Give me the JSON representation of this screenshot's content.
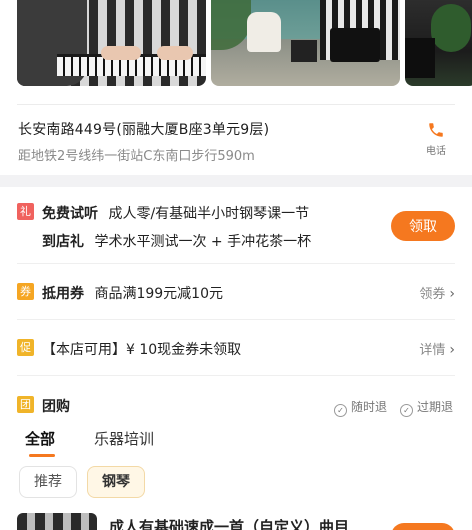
{
  "address": {
    "line": "长安南路449号(丽融大厦B座3单元9层)",
    "sub": "距地铁2号线纬一街站C东南口步行590m",
    "phone_label": "电话"
  },
  "offers": {
    "gift": {
      "tag": "礼",
      "line1_bold": "免费试听",
      "line1_text": "成人零/有基础半小时钢琴课一节",
      "line2_bold": "到店礼",
      "line2_text": "学术水平测试一次 + 手冲花茶一杯",
      "button": "领取"
    },
    "coupon": {
      "tag": "券",
      "label_bold": "抵用券",
      "text": "商品满199元减10元",
      "action": "领券"
    },
    "cash": {
      "tag": "促",
      "text": "【本店可用】¥ 10现金券未领取",
      "action": "详情"
    }
  },
  "groupbuy": {
    "tag": "团",
    "title": "团购",
    "features": [
      "随时退",
      "过期退"
    ],
    "tabs": [
      "全部",
      "乐器培训"
    ],
    "chips": [
      "推荐",
      "钢琴"
    ],
    "deal_title": "成人有基础速成一首（自定义）曲目"
  },
  "colors": {
    "accent": "#f5781f",
    "gift_tag": "#f0625e",
    "coupon_tag": "#f5a623"
  }
}
